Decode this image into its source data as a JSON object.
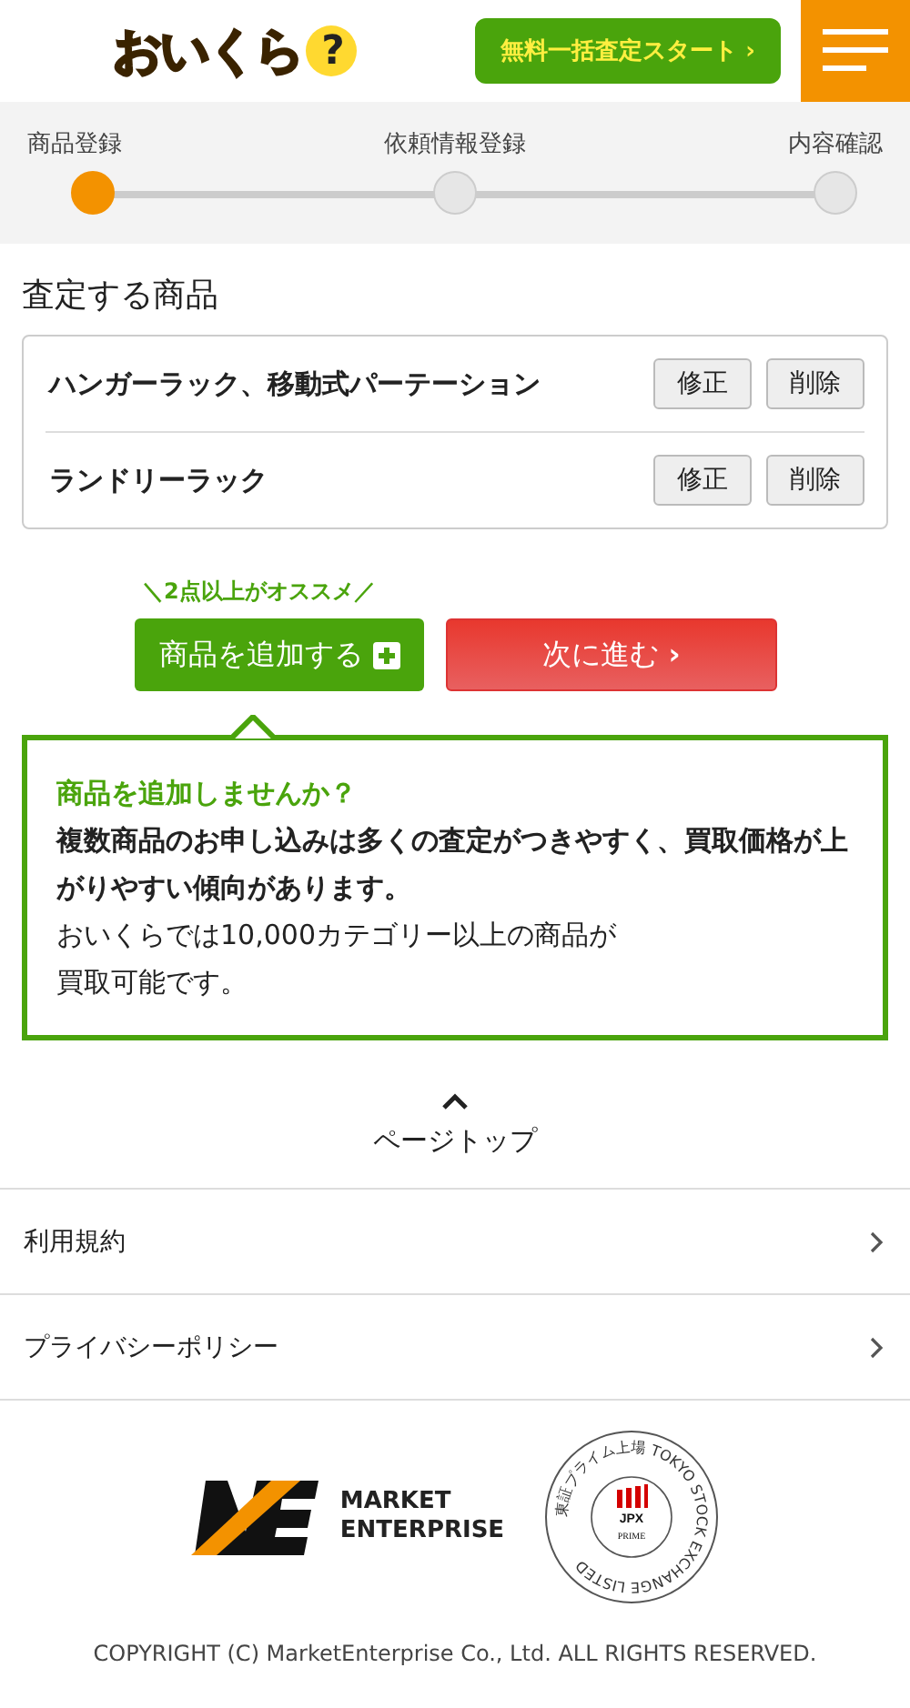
{
  "header": {
    "logo": "おいくら",
    "logo_mark": "?",
    "cta": "無料一括査定スタート",
    "cta_arrow": "›"
  },
  "steps": [
    {
      "label": "商品登録",
      "selected": true
    },
    {
      "label": "依頼情報登録",
      "selected": false
    },
    {
      "label": "内容確認",
      "selected": false
    }
  ],
  "section_title": "査定する商品",
  "items": [
    {
      "name": "ハンガーラック、移動式パーテーション",
      "edit": "修正",
      "delete": "削除"
    },
    {
      "name": "ランドリーラック",
      "edit": "修正",
      "delete": "削除"
    }
  ],
  "recommend": "＼2点以上がオススメ／",
  "add_button": "商品を追加する",
  "next_button": "次に進む",
  "next_arrow": "›",
  "callout": {
    "title": "商品を追加しませんか？",
    "bold": "複数商品のお申し込みは多くの査定がつきやすく、買取価格が上がりやすい傾向があります。",
    "lines": [
      "おいくらでは10,000カテゴリー以上の商品が",
      "買取可能です。"
    ]
  },
  "page_top": "ページトップ",
  "links": [
    {
      "label": "利用規約"
    },
    {
      "label": "プライバシーポリシー"
    }
  ],
  "company": {
    "line1": "MARKET",
    "line2": "ENTERPRISE"
  },
  "seal": {
    "ring": "東証プライム上場 TOKYO STOCK EXCHANGE LISTED",
    "mark": "JPX",
    "grade": "PRIME"
  },
  "copyright": "COPYRIGHT (C) MarketEnterprise Co., Ltd. ALL RIGHTS RESERVED."
}
